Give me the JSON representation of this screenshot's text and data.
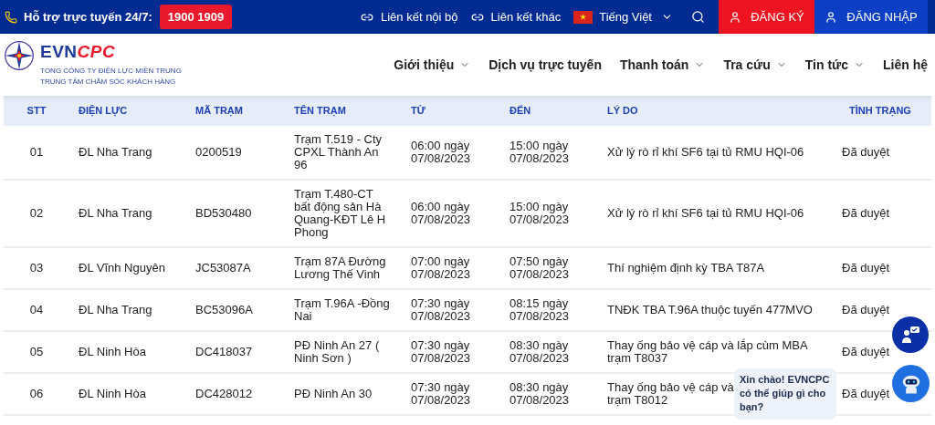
{
  "top_bar": {
    "hotline_label": "Hỗ trợ trực tuyến 24/7:",
    "hotline_number": "1900 1909",
    "links": [
      "Liên kết nội bộ",
      "Liên kết khác"
    ],
    "language": "Tiếng Việt",
    "register": "ĐĂNG KÝ",
    "login": "ĐĂNG NHẬP"
  },
  "logo": {
    "brand_primary": "EVN",
    "brand_secondary": "CPC",
    "line_1": "TỔNG CÔNG TY ĐIỆN LỰC MIỀN TRUNG",
    "line_2": "TRUNG TÂM CHĂM SÓC KHÁCH HÀNG"
  },
  "nav": [
    {
      "label": "Giới thiệu",
      "dropdown": true
    },
    {
      "label": "Dịch vụ trực tuyến",
      "dropdown": false
    },
    {
      "label": "Thanh toán",
      "dropdown": true
    },
    {
      "label": "Tra cứu",
      "dropdown": true
    },
    {
      "label": "Tin tức",
      "dropdown": true
    },
    {
      "label": "Liên hệ",
      "dropdown": false
    }
  ],
  "table": {
    "columns": [
      "STT",
      "ĐIỆN LỰC",
      "MÃ TRẠM",
      "TÊN TRẠM",
      "TỪ",
      "ĐẾN",
      "LÝ DO",
      "TÌNH TRẠNG"
    ],
    "rows": [
      [
        "01",
        "ĐL Nha Trang",
        "0200519",
        "Trạm T.519 - Cty CPXL Thành An 96",
        "06:00 ngày 07/08/2023",
        "15:00 ngày 07/08/2023",
        "Xử lý rò rỉ khí SF6 tại tủ RMU HQI-06",
        "Đã duyệt"
      ],
      [
        "02",
        "ĐL Nha Trang",
        "BD530480",
        "Trạm T.480-CT bất động sản Hà Quang-KĐT Lê H Phong",
        "06:00 ngày 07/08/2023",
        "15:00 ngày 07/08/2023",
        "Xử lý rò rỉ khí SF6 tại tủ RMU HQI-06",
        "Đã duyệt"
      ],
      [
        "03",
        "ĐL Vĩnh Nguyên",
        "JC53087A",
        "Trạm 87A Đường Lương Thế Vinh",
        "07:00 ngày 07/08/2023",
        "07:50 ngày 07/08/2023",
        "Thí nghiệm định kỳ TBA T87A",
        "Đã duyệt"
      ],
      [
        "04",
        "ĐL Nha Trang",
        "BC53096A",
        "Trạm T.96A -Đồng Nai",
        "07:30 ngày 07/08/2023",
        "08:15 ngày 07/08/2023",
        "TNĐK TBA T.96A thuộc tuyến 477MVO",
        "Đã duyệt"
      ],
      [
        "05",
        "ĐL Ninh Hòa",
        "DC418037",
        "PĐ Ninh An 27 ( Ninh Sơn )",
        "07:30 ngày 07/08/2023",
        "08:30 ngày 07/08/2023",
        "Thay ống bảo vệ cáp và lắp cùm MBA trạm T8037",
        "Đã duyệt"
      ],
      [
        "06",
        "ĐL Ninh Hòa",
        "DC428012",
        "PĐ Ninh An 30",
        "07:30 ngày 07/08/2023",
        "08:30 ngày 07/08/2023",
        [
          "Thay ống bảo vệ cáp và",
          "trạm T8012"
        ],
        "Đã duyệt"
      ]
    ]
  },
  "chat": {
    "greeting": "Xin chào! EVNCPC có thể giúp gì cho bạn?"
  }
}
